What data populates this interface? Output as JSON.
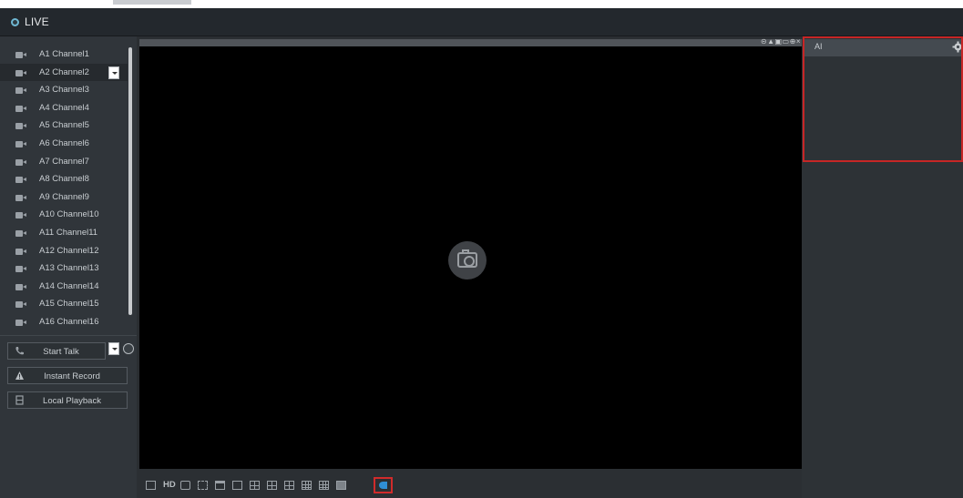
{
  "app": {
    "title": "LIVE"
  },
  "channels": [
    {
      "label": "A1 Channel1",
      "selected": false
    },
    {
      "label": "A2 Channel2",
      "selected": true
    },
    {
      "label": "A3 Channel3",
      "selected": false
    },
    {
      "label": "A4 Channel4",
      "selected": false
    },
    {
      "label": "A5 Channel5",
      "selected": false
    },
    {
      "label": "A6 Channel6",
      "selected": false
    },
    {
      "label": "A7 Channel7",
      "selected": false
    },
    {
      "label": "A8 Channel8",
      "selected": false
    },
    {
      "label": "A9 Channel9",
      "selected": false
    },
    {
      "label": "A10 Channel10",
      "selected": false
    },
    {
      "label": "A11 Channel11",
      "selected": false
    },
    {
      "label": "A12 Channel12",
      "selected": false
    },
    {
      "label": "A13 Channel13",
      "selected": false
    },
    {
      "label": "A14 Channel14",
      "selected": false
    },
    {
      "label": "A15 Channel15",
      "selected": false
    },
    {
      "label": "A16 Channel16",
      "selected": false
    }
  ],
  "actions": {
    "start_talk": "Start Talk",
    "instant_record": "Instant Record",
    "local_playback": "Local Playback"
  },
  "video": {
    "header_tools": "⊝▲▣▭⊕×"
  },
  "toolbar": {
    "hd_label": "HD",
    "icons": [
      "stream-icon",
      "hd-icon",
      "fisheye-icon",
      "fullscreen-icon",
      "split-1-icon",
      "split-1x1-icon",
      "split-4-icon",
      "split-6-icon",
      "split-8-icon",
      "split-9-icon",
      "split-13-icon",
      "split-16-icon",
      "ai-split-icon"
    ]
  },
  "ai_panel": {
    "title": "AI"
  },
  "colors": {
    "highlight": "#d12b2b",
    "accent": "#2f8fd6"
  }
}
